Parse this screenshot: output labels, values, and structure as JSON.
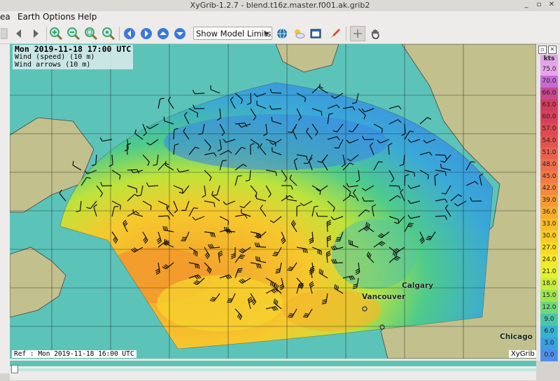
{
  "window": {
    "title": "XyGrib-1.2.7 - blend.t16z.master.f001.ak.grib2",
    "minimize": "_",
    "restore": "▫",
    "close": "✕"
  },
  "menu": {
    "items": [
      "ea",
      "Earth",
      "Options",
      "Help"
    ]
  },
  "toolbar": {
    "model_limits": "Show Model Limits"
  },
  "info": {
    "datetime": "Mon 2019-11-18 17:00 UTC",
    "layer1": "Wind (speed) (10 m)",
    "layer2": "Wind arrows (10 m)"
  },
  "ref": "Ref : Mon 2019-11-18 16:00 UTC",
  "brand": "XyGrib",
  "cities": [
    "Calgary",
    "Vancouver",
    "Chicago"
  ],
  "colorbar": {
    "unit": "kts",
    "values": [
      "75.0",
      "70.0",
      "66.0",
      "63.0",
      "60.0",
      "57.0",
      "54.0",
      "51.0",
      "48.0",
      "45.0",
      "42.0",
      "39.0",
      "36.0",
      "33.0",
      "30.0",
      "27.0",
      "24.0",
      "21.0",
      "18.0",
      "15.0",
      "12.0",
      "9.0",
      "6.0",
      "3.0",
      "0.0"
    ],
    "colors": [
      "#e9a3ec",
      "#c66bd6",
      "#c9478e",
      "#d33d5d",
      "#d8405a",
      "#dd4a52",
      "#e15450",
      "#e8614f",
      "#ed6e4c",
      "#f27a46",
      "#f4893f",
      "#f69a36",
      "#f7ab2f",
      "#f8bb2a",
      "#f9cb26",
      "#f7da26",
      "#f4e82a",
      "#e6f02e",
      "#c9ec3a",
      "#9fe44f",
      "#6fd97a",
      "#4ac6a9",
      "#38b2cf",
      "#3aa0e3",
      "#4f8ee8"
    ]
  }
}
